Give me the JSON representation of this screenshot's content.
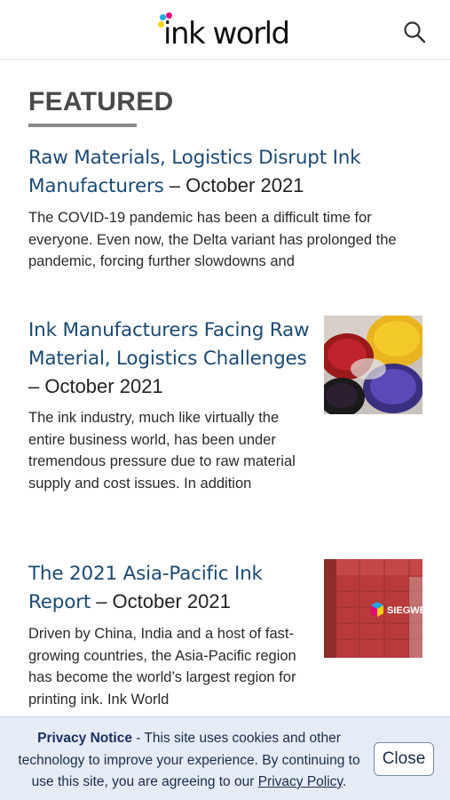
{
  "header": {
    "logo_text": "ink world",
    "logo_dot_colors": [
      "#1fa9e1",
      "#e6007e",
      "#ffd100",
      "#222222"
    ],
    "search_icon": "search-icon"
  },
  "section": {
    "title": "FEATURED"
  },
  "articles": [
    {
      "title": "Raw Materials, Logistics Disrupt Ink Manufacturers",
      "date": " – October 2021",
      "excerpt": "The COVID-19 pandemic has been a difficult time for everyone. Even now, the Delta variant has prolonged the pandemic, forcing further slowdowns and"
    },
    {
      "title": "Ink Manufacturers Facing Raw Material, Logistics Challenges",
      "date": " – October 2021",
      "excerpt": "The ink industry, much like virtually the entire business world, has been under tremendous pressure due to raw material supply and cost issues. In addition",
      "image": "pigment-bowls-image"
    },
    {
      "title": "The 2021 Asia-Pacific Ink Report",
      "date": " – October 2021",
      "excerpt": "Driven by China, India and a host of fast-growing countries, the Asia-Pacific region has become the world’s largest region for printing ink. Ink World",
      "image": "siegwerk-building-image",
      "image_sign": "SIEGWERK"
    }
  ],
  "privacy": {
    "label": "Privacy Notice",
    "text": " - This site uses cookies and other technology to improve your experience. By continuing to use this site, you are agreeing to our ",
    "link": "Privacy Policy",
    "end": ".",
    "close_label": "Close"
  }
}
